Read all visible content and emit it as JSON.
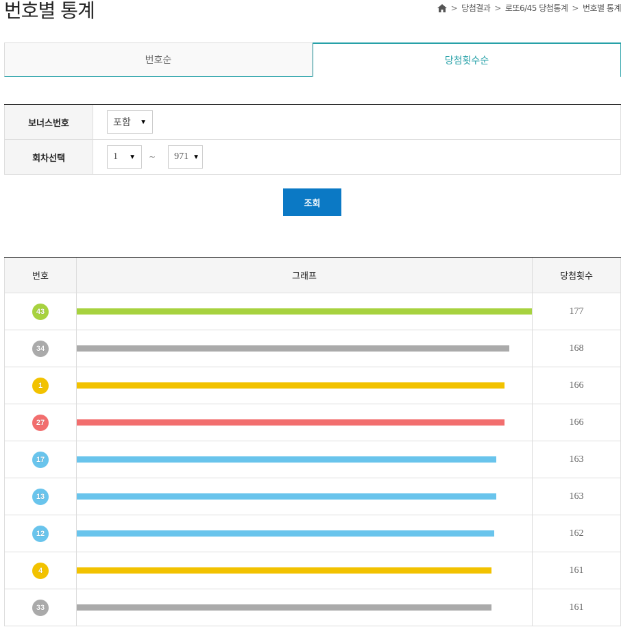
{
  "page": {
    "title": "번호별 통계"
  },
  "breadcrumb": [
    "당첨결과",
    "로또6/45 당첨통계",
    "번호별 통계"
  ],
  "tabs": [
    {
      "label": "번호순",
      "active": false
    },
    {
      "label": "당첨횟수순",
      "active": true
    }
  ],
  "search": {
    "bonus_label": "보너스번호",
    "bonus_value": "포함",
    "round_label": "회차선택",
    "round_from": "1",
    "round_sep": "~",
    "round_to": "971",
    "button_label": "조회"
  },
  "table": {
    "headers": [
      "번호",
      "그래프",
      "당첨횟수"
    ],
    "max_count": 177,
    "rows": [
      {
        "number": "43",
        "count": 177,
        "color": "#a7d23f"
      },
      {
        "number": "34",
        "count": 168,
        "color": "#aaaaaa"
      },
      {
        "number": "1",
        "count": 166,
        "color": "#f2c200"
      },
      {
        "number": "27",
        "count": 166,
        "color": "#f26e6e"
      },
      {
        "number": "17",
        "count": 163,
        "color": "#69c4ec"
      },
      {
        "number": "13",
        "count": 163,
        "color": "#69c4ec"
      },
      {
        "number": "12",
        "count": 162,
        "color": "#69c4ec"
      },
      {
        "number": "4",
        "count": 161,
        "color": "#f2c200"
      },
      {
        "number": "33",
        "count": 161,
        "color": "#aaaaaa"
      }
    ]
  }
}
